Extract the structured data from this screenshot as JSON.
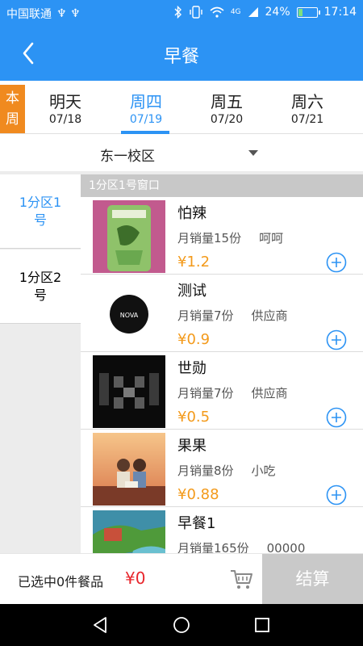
{
  "status_bar": {
    "carrier": "中国联通",
    "usb_glyphs": "♆ ♆",
    "net_label": "4G",
    "battery_pct": "24%",
    "battery_level": 0.24,
    "time": "17:14"
  },
  "header": {
    "title": "早餐",
    "back_icon": "chevron-left-icon"
  },
  "week_badge": "本周",
  "days": [
    {
      "name": "明天",
      "date": "07/18"
    },
    {
      "name": "周四",
      "date": "07/19"
    },
    {
      "name": "周五",
      "date": "07/20"
    },
    {
      "name": "周六",
      "date": "07/21"
    }
  ],
  "active_day_index": 1,
  "campus": {
    "selected": "东一校区",
    "icon": "dropdown-triangle-icon"
  },
  "sidebar": {
    "items": [
      {
        "label_line1": "1分区1",
        "label_line2": "号",
        "active": true
      },
      {
        "label_line1": "1分区2",
        "label_line2": "号",
        "active": false
      }
    ]
  },
  "list": {
    "section_header": "1分区1号窗口",
    "items": [
      {
        "name": "怕辣",
        "sales": "月销量15份",
        "vendor": "呵呵",
        "price": "¥1.2"
      },
      {
        "name": "测试",
        "sales": "月销量7份",
        "vendor": "供应商",
        "price": "¥0.9",
        "thumb_text": "NOVA"
      },
      {
        "name": "世勋",
        "sales": "月销量7份",
        "vendor": "供应商",
        "price": "¥0.5"
      },
      {
        "name": "果果",
        "sales": "月销量8份",
        "vendor": "小吃",
        "price": "¥0.88"
      },
      {
        "name": "早餐1",
        "sales": "月销量165份",
        "vendor": "00000",
        "price": ""
      }
    ]
  },
  "cart": {
    "selected_text": "已选中0件餐品",
    "total": "¥0",
    "checkout_label": "结算"
  },
  "colors": {
    "primary": "#2c93f4",
    "accent_orange": "#f08a1f",
    "price_orange": "#f39a1b",
    "total_red": "#e8262c"
  }
}
